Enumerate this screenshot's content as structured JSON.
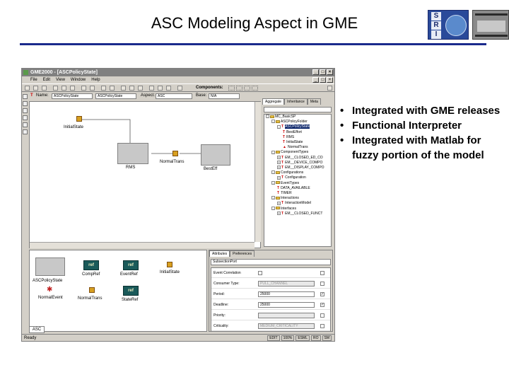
{
  "slide": {
    "title": "ASC Modeling Aspect in GME",
    "bullets": [
      "Integrated with GME releases",
      "Functional Interpreter",
      "Integrated with Matlab for fuzzy portion of the model"
    ]
  },
  "logos": {
    "sri_letters": [
      "S",
      "R",
      "I"
    ]
  },
  "window": {
    "title": "GME2000 - [ASCPolicyState]",
    "menu": [
      "File",
      "Edit",
      "View",
      "Window",
      "Help"
    ],
    "components_label": "Components:",
    "prop_bar": {
      "name_label": "Name:",
      "name_value": "ASCPolicyState",
      "type_value": "ASCPolicyState",
      "aspect_label": "Aspect:",
      "aspect_value": "ASC",
      "base_label": "Base:",
      "base_value": "N/A"
    },
    "canvas_nodes": {
      "initial_state": "InitialState",
      "rms": "RMS",
      "normal_trans": "NormalTrans",
      "best_eff": "BestEff"
    },
    "browser": {
      "tabs": [
        "Aggregate",
        "Inheritance",
        "Meta"
      ],
      "tree": [
        {
          "text": "MC_BasicSP",
          "indent": 0,
          "kind": "folder",
          "exp": "-"
        },
        {
          "text": "ASCPolicyFolder",
          "indent": 1,
          "kind": "folder",
          "exp": "-"
        },
        {
          "text": "ASCPolicyState",
          "indent": 2,
          "kind": "T",
          "exp": "-",
          "selected": true
        },
        {
          "text": "BestEffort",
          "indent": 3,
          "kind": "T",
          "exp": ""
        },
        {
          "text": "RMS",
          "indent": 3,
          "kind": "T",
          "exp": ""
        },
        {
          "text": "InitialState",
          "indent": 3,
          "kind": "T",
          "exp": ""
        },
        {
          "text": "NormalTrans",
          "indent": 3,
          "kind": "A",
          "exp": ""
        },
        {
          "text": "ComponentTypes",
          "indent": 1,
          "kind": "folder",
          "exp": "-"
        },
        {
          "text": "EM__CLOSED_ED_CO",
          "indent": 2,
          "kind": "T",
          "exp": "+"
        },
        {
          "text": "EM__DEVICE_COMPO",
          "indent": 2,
          "kind": "T",
          "exp": "+"
        },
        {
          "text": "EM__DISPLAY_COMPO",
          "indent": 2,
          "kind": "T",
          "exp": "+"
        },
        {
          "text": "Configurations",
          "indent": 1,
          "kind": "folder",
          "exp": "-"
        },
        {
          "text": "Configuration",
          "indent": 2,
          "kind": "T",
          "exp": "+"
        },
        {
          "text": "EventTypes",
          "indent": 1,
          "kind": "folder",
          "exp": "-"
        },
        {
          "text": "DATA_AVAILABLE",
          "indent": 2,
          "kind": "T",
          "exp": ""
        },
        {
          "text": "TIMER",
          "indent": 2,
          "kind": "T",
          "exp": ""
        },
        {
          "text": "Interactions",
          "indent": 1,
          "kind": "folder",
          "exp": "-"
        },
        {
          "text": "InteractionModel",
          "indent": 2,
          "kind": "T",
          "exp": "+"
        },
        {
          "text": "Interfaces",
          "indent": 1,
          "kind": "folder",
          "exp": "-"
        },
        {
          "text": "EM__CLOSED_FUNCT",
          "indent": 2,
          "kind": "T",
          "exp": "+"
        }
      ]
    },
    "parts": {
      "asc_policy_state": "ASCPolicyState",
      "comp_ref": "CompRef",
      "event_ref": "EventRef",
      "initial_state": "InitialState",
      "normal_event": "NormalEvent",
      "normal_trans": "NormalTrans",
      "state_ref": "StateRef",
      "ref_text": "ref",
      "tab": "ASC"
    },
    "attributes": {
      "tabs": [
        "Attributes",
        "Preferences"
      ],
      "name_value": "SubsectionPort",
      "rows": [
        {
          "key": "Event Correlation",
          "value": "",
          "type": "check",
          "disabled": false
        },
        {
          "key": "Consumer Type:",
          "value": "PULL_CHANNEL",
          "type": "select",
          "disabled": true
        },
        {
          "key": "Period:",
          "value": "25000",
          "type": "text",
          "disabled": false,
          "checked": true
        },
        {
          "key": "Deadline:",
          "value": "25000",
          "type": "text",
          "disabled": false,
          "checked": true
        },
        {
          "key": "Priority:",
          "value": "",
          "type": "text",
          "disabled": true
        },
        {
          "key": "Criticality:",
          "value": "MEDIUM_CRITICALITY",
          "type": "select",
          "disabled": true
        }
      ]
    },
    "status": {
      "text": "Ready",
      "cells": [
        "EDIT",
        "100%",
        "ESML",
        "RO",
        "SM"
      ]
    }
  }
}
